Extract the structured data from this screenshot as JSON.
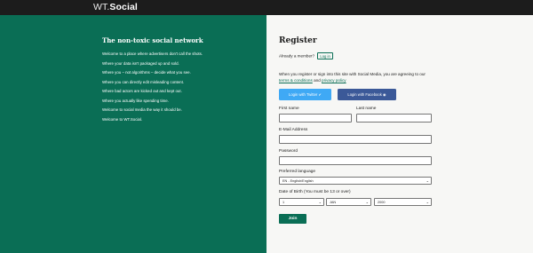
{
  "header": {
    "logo_wt": "WT.",
    "logo_social": "Social"
  },
  "intro": {
    "title": "The non-toxic social network",
    "lines": [
      "Welcome to a place where advertisers don't call the shots.",
      "Where your data isn't packaged up and sold.",
      "Where you – not algorithms – decide what you see.",
      "Where you can directly edit misleading content.",
      "Where bad actors are kicked out and kept out.",
      "Where you actually like spending time.",
      "Welcome to social media the way it should be.",
      "Welcome to WT.Social."
    ]
  },
  "register": {
    "title": "Register",
    "already_member": "Already a member?",
    "login_label": "Log in",
    "agree_prefix": "When you register or sign into this site with Social Media, you are agreeing to our",
    "terms_label": "terms & conditions",
    "and_text": "and",
    "privacy_label": "privacy policy",
    "twitter_label": "Login with Twitter ✔",
    "facebook_label": "Login with Facebook ◉",
    "first_name_label": "First name",
    "last_name_label": "Last name",
    "email_label": "E-Mail Address",
    "password_label": "Password",
    "language_label": "Preferred language",
    "language_value": "EN - English/English",
    "dob_label": "Date of Birth (You must be 13 or over)",
    "dob_day": "1",
    "dob_month": "JAN",
    "dob_year": "2000",
    "join_label": "Join"
  },
  "colors": {
    "brand_green": "#0a6e55",
    "twitter": "#3fa9f5",
    "facebook": "#3b5998",
    "topbar": "#1c1c1c"
  }
}
